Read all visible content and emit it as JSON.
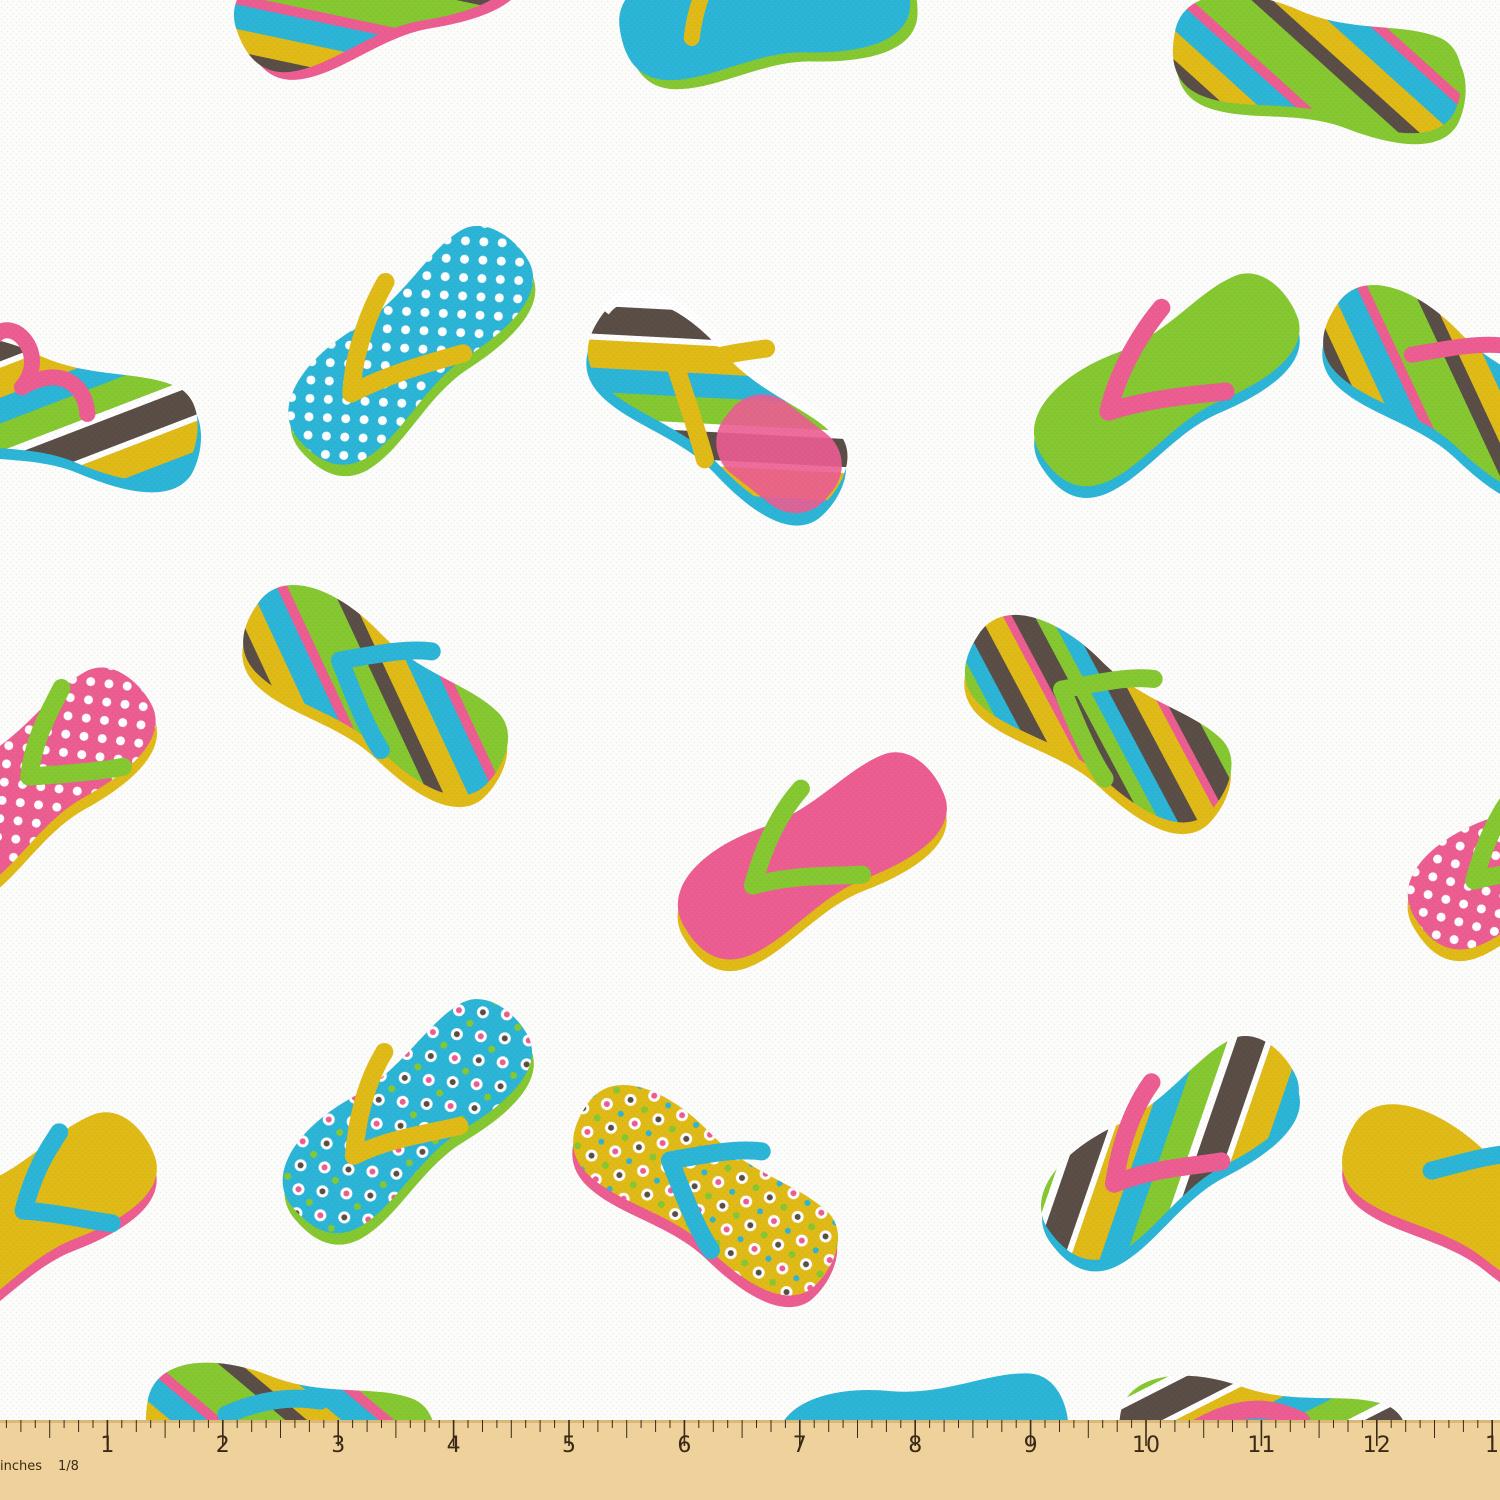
{
  "fabric": {
    "background": "#fcfcfa",
    "palette": {
      "pink": "#ec5d92",
      "green": "#86c832",
      "blue": "#2cb5d6",
      "yellow": "#e0bb18",
      "brown": "#5a4e47",
      "white": "#ffffff"
    },
    "motif": "flip-flop sandals (striped, polka-dot, circle-dot and solid)"
  },
  "ruler": {
    "unit_label": "inches",
    "fraction_label": "1/8",
    "numbers": [
      "1",
      "2",
      "3",
      "4",
      "5",
      "6",
      "7",
      "8",
      "9",
      "10",
      "11",
      "12",
      "1"
    ],
    "wood_color": "#efd29b",
    "mark_color": "#3a2a17"
  }
}
